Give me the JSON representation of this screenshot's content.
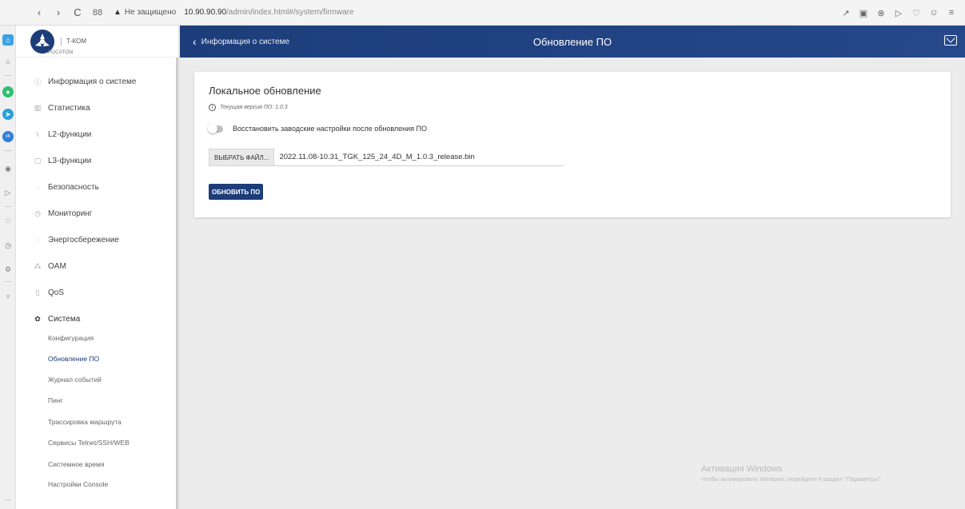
{
  "browser": {
    "back": "‹",
    "forward": "›",
    "reload": "C",
    "grid": "88",
    "security_warning": "Не защищено",
    "url_host": "10.90.90.90",
    "url_path": "/admin/index.html#/system/firmware",
    "right_icons": [
      "↗",
      "▣",
      "⊗",
      "▷",
      "♡",
      "☺",
      "≡"
    ]
  },
  "strip": {
    "bottom": "···"
  },
  "logo": {
    "line1": "Т-КОМ",
    "line2": "РОСАТОМ"
  },
  "sidebar": {
    "items": [
      {
        "icon": "ⓘ",
        "label": "Информация о системе"
      },
      {
        "icon": "▥",
        "label": "Статистика"
      },
      {
        "icon": "⑊",
        "label": "L2-функции"
      },
      {
        "icon": "▢",
        "label": "L3-функции"
      },
      {
        "icon": "◌",
        "label": "Безопасность"
      },
      {
        "icon": "◷",
        "label": "Мониторинг"
      },
      {
        "icon": "◌",
        "label": "Энергосбережение"
      },
      {
        "icon": "⁂",
        "label": "OAM"
      },
      {
        "icon": "▯",
        "label": "QoS"
      },
      {
        "icon": "✿",
        "label": "Система"
      }
    ],
    "subitems": [
      "Конфигурация",
      "Обновление ПО",
      "Журнал событий",
      "Пинг",
      "Трассировка маршрута",
      "Сервисы Telnet/SSH/WEB",
      "Системное время",
      "Настройки Console"
    ],
    "active_subitem": "Обновление ПО"
  },
  "header": {
    "back_label": "Информация о системе",
    "title": "Обновление ПО"
  },
  "card": {
    "title": "Локальное обновление",
    "version": "Текущая версия ПО: 1.0.3",
    "toggle_label": "Восстановить заводские настройки после обновления ПО",
    "toggle_on": false,
    "file_button": "ВЫБРАТЬ ФАЙЛ...",
    "file_name": "2022.11.08-10.31_TGK_125_24_4D_M_1.0.3_release.bin",
    "update_button": "ОБНОВИТЬ ПО"
  },
  "watermark": {
    "line1": "Активация Windows",
    "line2": "Чтобы активировать Windows, перейдите в раздел \"Параметры\"."
  }
}
